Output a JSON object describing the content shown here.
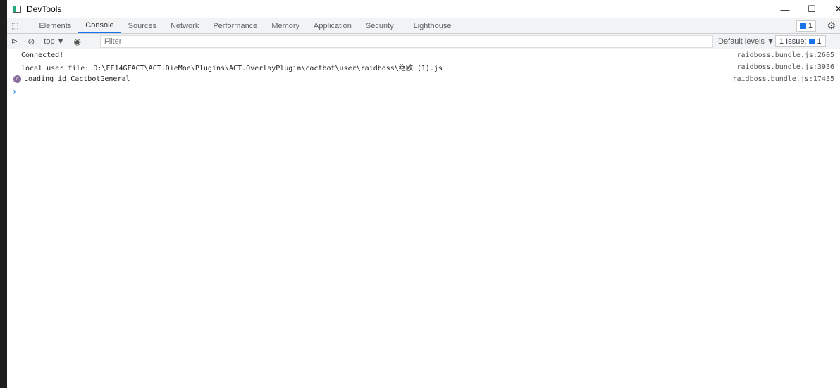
{
  "window": {
    "title": "DevTools",
    "minimize": "—",
    "maximize": "☐",
    "close": "✕"
  },
  "tabs": [
    "Elements",
    "Console",
    "Sources",
    "Network",
    "Performance",
    "Memory",
    "Application",
    "Security",
    "Lighthouse"
  ],
  "active_tab": "Console",
  "issues_badge": "1",
  "toolbar": {
    "context": "top ▼",
    "filter_placeholder": "Filter",
    "levels": "Default levels ▼",
    "issues_label": "1 Issue:",
    "issues_count": "1"
  },
  "console": [
    {
      "text": "Connected!",
      "source": "raidboss.bundle.js:2605"
    },
    {
      "text": "local user file: D:\\FF14GFACT\\ACT.DieMoe\\Plugins\\ACT.OverlayPlugin\\cactbot\\user\\raidboss\\绝欧 (1).js",
      "source": "raidboss.bundle.js:3936"
    },
    {
      "text": "Loading id CactbotGeneral",
      "source": "raidboss.bundle.js:17435",
      "repeat": "4"
    }
  ],
  "prompt": "›",
  "colors": {
    "accent": "#1a73e8",
    "repeat_badge": "#8a6f9c"
  }
}
